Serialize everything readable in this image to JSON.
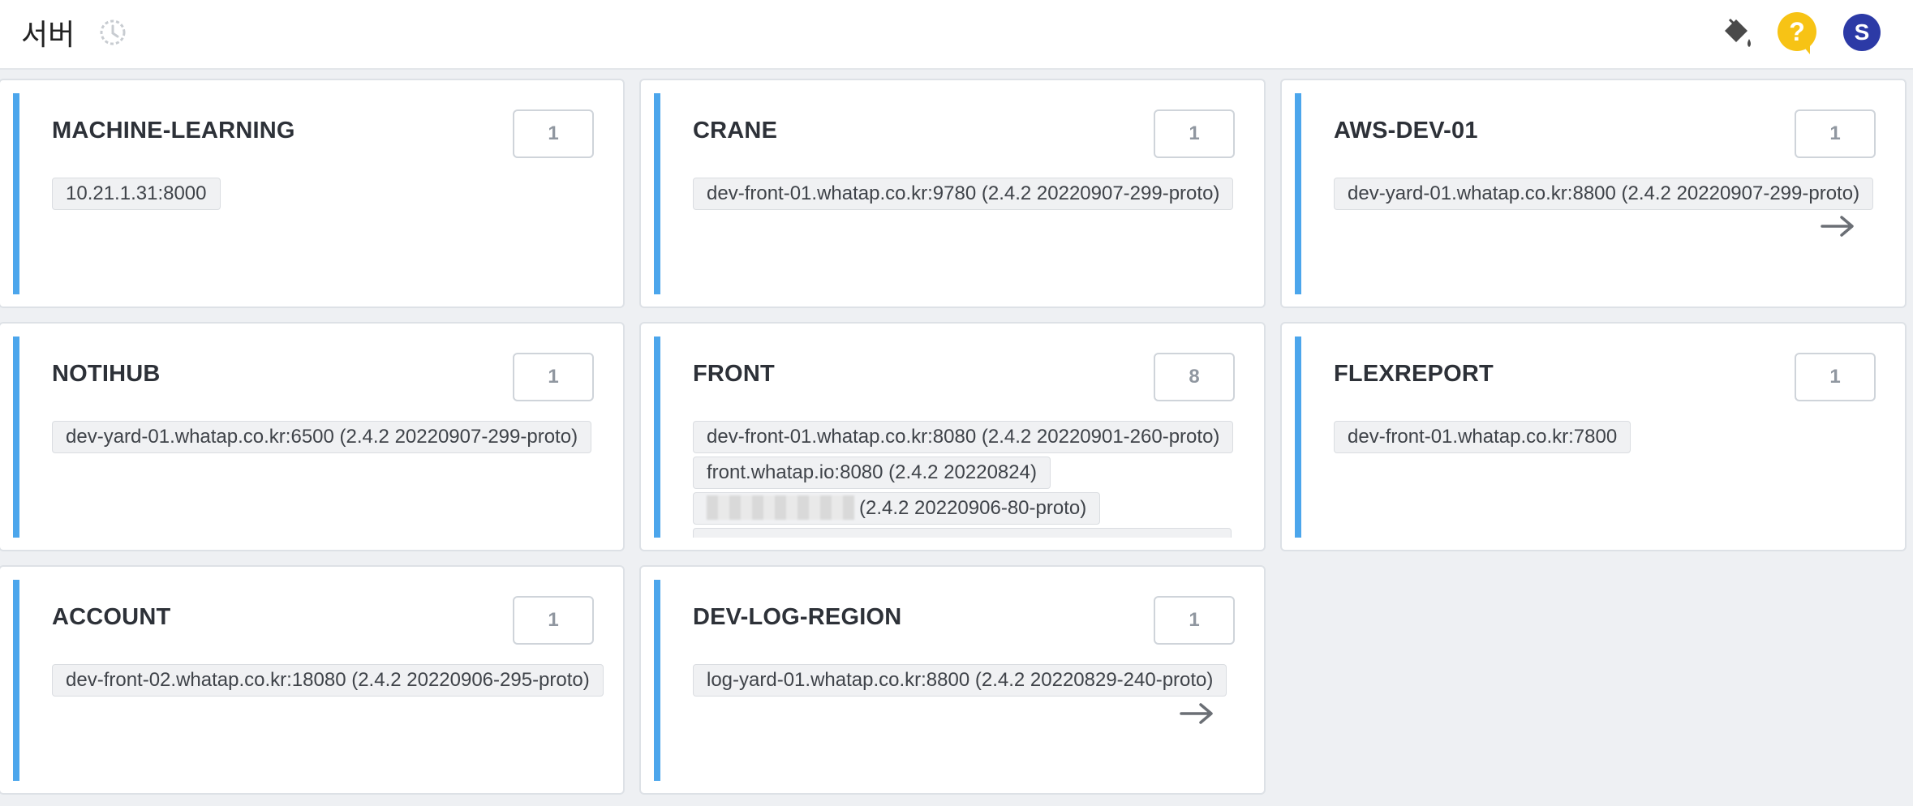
{
  "header": {
    "title": "서버",
    "icons": [
      "history-icon",
      "paint-bucket-icon",
      "help-icon",
      "avatar"
    ],
    "help_label": "?",
    "avatar_initial": "S",
    "colors": {
      "help": "#f7c315",
      "avatar": "#2c3aa6",
      "accent": "#4ca6ec"
    }
  },
  "cards": [
    {
      "name": "MACHINE-LEARNING",
      "count": "1",
      "instances": [
        "10.21.1.31:8000"
      ]
    },
    {
      "name": "CRANE",
      "count": "1",
      "instances": [
        "dev-front-01.whatap.co.kr:9780 (2.4.2 20220907-299-proto)"
      ]
    },
    {
      "name": "AWS-DEV-01",
      "count": "1",
      "instances": [
        "dev-yard-01.whatap.co.kr:8800 (2.4.2 20220907-299-proto)"
      ]
    },
    {
      "name": "NOTIHUB",
      "count": "1",
      "instances": [
        "dev-yard-01.whatap.co.kr:6500 (2.4.2 20220907-299-proto)"
      ]
    },
    {
      "name": "FRONT",
      "count": "8",
      "instances": [
        "dev-front-01.whatap.co.kr:8080 (2.4.2 20220901-260-proto)",
        "front.whatap.io:8080 (2.4.2 20220824)",
        "(2.4.2 20220906-80-proto)"
      ]
    },
    {
      "name": "FLEXREPORT",
      "count": "1",
      "instances": [
        "dev-front-01.whatap.co.kr:7800"
      ]
    },
    {
      "name": "ACCOUNT",
      "count": "1",
      "instances": [
        "dev-front-02.whatap.co.kr:18080 (2.4.2 20220906-295-proto)"
      ]
    },
    {
      "name": "DEV-LOG-REGION",
      "count": "1",
      "instances": [
        "log-yard-01.whatap.co.kr:8800 (2.4.2 20220829-240-proto)"
      ]
    }
  ]
}
